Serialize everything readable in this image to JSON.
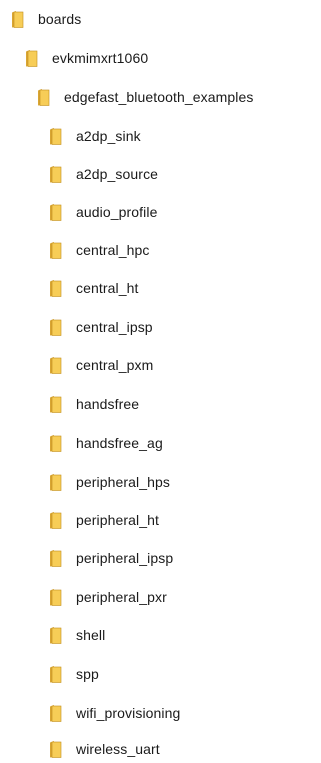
{
  "tree": {
    "root": {
      "label": "boards",
      "icon": "folder-icon"
    },
    "board": {
      "label": "evkmimxrt1060",
      "icon": "folder-icon"
    },
    "examples_folder": {
      "label": "edgefast_bluetooth_examples",
      "icon": "folder-icon"
    },
    "items": [
      {
        "label": "a2dp_sink",
        "icon": "folder-icon"
      },
      {
        "label": "a2dp_source",
        "icon": "folder-icon"
      },
      {
        "label": "audio_profile",
        "icon": "folder-icon"
      },
      {
        "label": "central_hpc",
        "icon": "folder-icon"
      },
      {
        "label": "central_ht",
        "icon": "folder-icon"
      },
      {
        "label": "central_ipsp",
        "icon": "folder-icon"
      },
      {
        "label": "central_pxm",
        "icon": "folder-icon"
      },
      {
        "label": "handsfree",
        "icon": "folder-icon"
      },
      {
        "label": "handsfree_ag",
        "icon": "folder-icon"
      },
      {
        "label": "peripheral_hps",
        "icon": "folder-icon"
      },
      {
        "label": "peripheral_ht",
        "icon": "folder-icon"
      },
      {
        "label": "peripheral_ipsp",
        "icon": "folder-icon"
      },
      {
        "label": "peripheral_pxr",
        "icon": "folder-icon"
      },
      {
        "label": "shell",
        "icon": "folder-icon"
      },
      {
        "label": "spp",
        "icon": "folder-icon"
      },
      {
        "label": "wifi_provisioning",
        "icon": "folder-icon"
      },
      {
        "label": "wireless_uart",
        "icon": "folder-icon"
      }
    ]
  },
  "colors": {
    "folder_back": "#d9a634",
    "folder_front": "#f7cd57",
    "folder_edge": "#c28e1c"
  }
}
